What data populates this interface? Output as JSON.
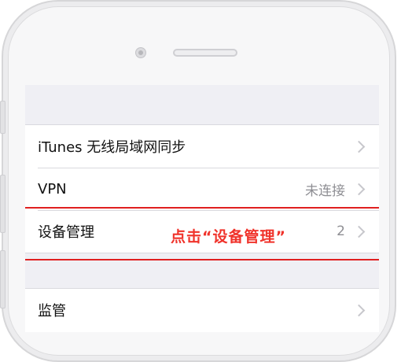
{
  "settings": {
    "group1": [
      {
        "label": "iTunes 无线局域网同步",
        "value": ""
      },
      {
        "label": "VPN",
        "value": "未连接"
      },
      {
        "label": "设备管理",
        "value": "2"
      }
    ],
    "group2": [
      {
        "label": "监管",
        "value": ""
      }
    ]
  },
  "annotation": {
    "text": "点击“设备管理”",
    "color": "#f0332b"
  }
}
